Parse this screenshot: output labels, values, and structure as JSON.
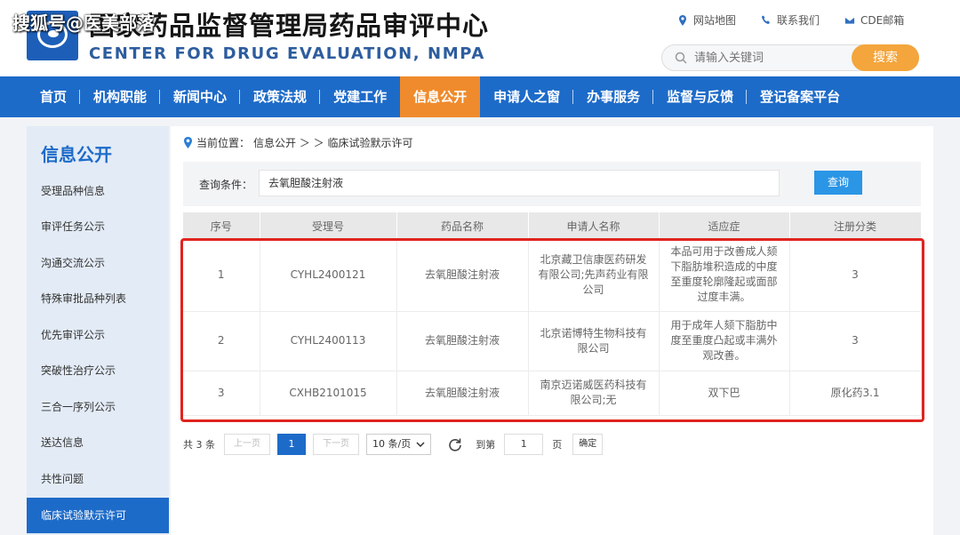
{
  "watermark": "搜狐号@医美部落",
  "header": {
    "title_cn": "国家药品监督管理局药品审评中心",
    "title_en": "CENTER FOR DRUG EVALUATION, NMPA",
    "links": [
      {
        "label": "网站地图",
        "icon": "location-icon"
      },
      {
        "label": "联系我们",
        "icon": "phone-icon"
      },
      {
        "label": "CDE邮箱",
        "icon": "mail-icon"
      }
    ],
    "search_placeholder": "请输入关键词",
    "search_button": "搜索"
  },
  "nav": {
    "items": [
      "首页",
      "机构职能",
      "新闻中心",
      "政策法规",
      "党建工作",
      "信息公开",
      "申请人之窗",
      "办事服务",
      "监督与反馈",
      "登记备案平台"
    ],
    "active_index": 5
  },
  "sidebar": {
    "title": "信息公开",
    "items": [
      "受理品种信息",
      "审评任务公示",
      "沟通交流公示",
      "特殊审批品种列表",
      "优先审评公示",
      "突破性治疗公示",
      "三合一序列公示",
      "送达信息",
      "共性问题",
      "临床试验默示许可"
    ],
    "active_index": 9
  },
  "breadcrumb": {
    "prefix": "当前位置：",
    "path": "信息公开 ＞ ＞ 临床试验默示许可"
  },
  "query": {
    "label": "查询条件：",
    "value": "去氧胆酸注射液",
    "button": "查询"
  },
  "table": {
    "headers": [
      "序号",
      "受理号",
      "药品名称",
      "申请人名称",
      "适应症",
      "注册分类"
    ],
    "rows": [
      [
        "1",
        "CYHL2400121",
        "去氧胆酸注射液",
        "北京藏卫信康医药研发有限公司;先声药业有限公司",
        "本品可用于改善成人颏下脂肪堆积造成的中度至重度轮廓隆起或面部过度丰满。",
        "3"
      ],
      [
        "2",
        "CYHL2400113",
        "去氧胆酸注射液",
        "北京诺博特生物科技有限公司",
        "用于成年人颏下脂肪中度至重度凸起或丰满外观改善。",
        "3"
      ],
      [
        "3",
        "CXHB2101015",
        "去氧胆酸注射液",
        "南京迈诺威医药科技有限公司;无",
        "双下巴",
        "原化药3.1"
      ]
    ]
  },
  "pager": {
    "total": "共 3 条",
    "prev": "上一页",
    "current": "1",
    "next": "下一页",
    "page_size": "10 条/页",
    "goto_label": "到第",
    "goto_value": "1",
    "page_unit": "页",
    "confirm": "确定"
  },
  "colors": {
    "nav_bg": "#1d6bc9",
    "nav_active": "#ef8b2c",
    "search_button": "#f4a53c",
    "query_button": "#2b95e6",
    "highlight": "#e0231e"
  }
}
